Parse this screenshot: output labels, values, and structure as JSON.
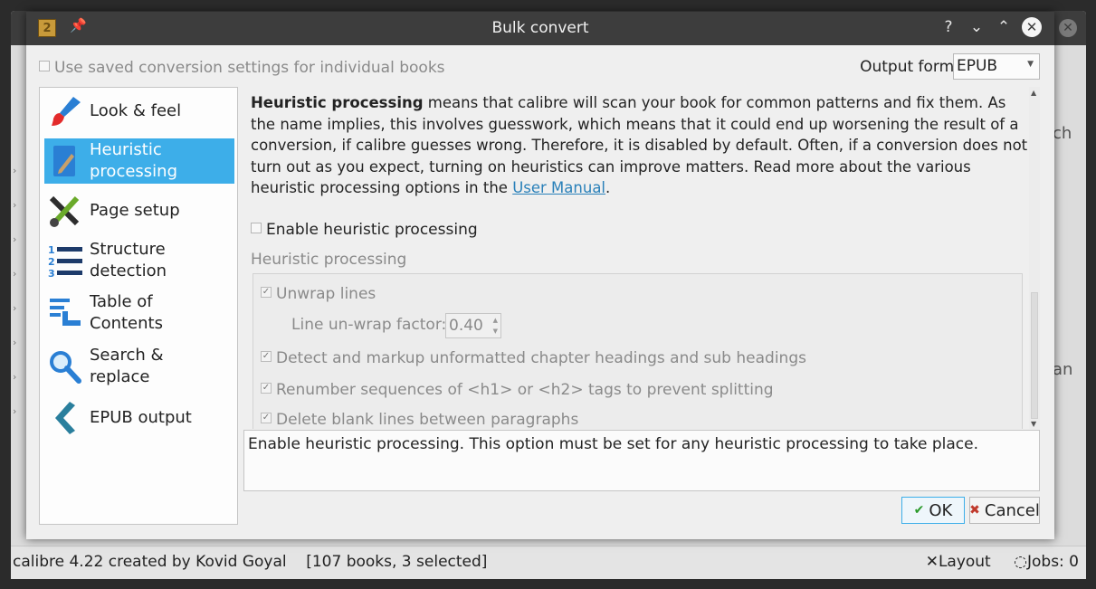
{
  "background": {
    "right_text_1": "ch",
    "right_text_2": "an",
    "status": {
      "left": "calibre 4.22 created by Kovid Goyal    [107 books, 3 selected]",
      "layout": "Layout",
      "jobs": "Jobs: 0"
    }
  },
  "dialog": {
    "title": "Bulk convert",
    "title_buttons": [
      "?",
      "⌄",
      "⌃",
      "✕"
    ],
    "use_saved_label": "Use saved conversion settings for individual books",
    "output_format_label": "Output format:",
    "output_format_value": "EPUB",
    "sidebar": [
      {
        "label": "Look & feel",
        "icon": "brush-icon"
      },
      {
        "label": "Heuristic processing",
        "icon": "pencil-icon",
        "selected": true
      },
      {
        "label": "Page setup",
        "icon": "tools-icon"
      },
      {
        "label": "Structure detection",
        "icon": "numbered-list-icon"
      },
      {
        "label": "Table of Contents",
        "icon": "toc-icon"
      },
      {
        "label": "Search & replace",
        "icon": "magnifier-icon"
      },
      {
        "label": "EPUB output",
        "icon": "chevron-left-icon"
      }
    ],
    "content": {
      "desc_bold": "Heuristic processing",
      "desc_text": " means that calibre will scan your book for common patterns and fix them. As the name implies, this involves guesswork, which means that it could end up worsening the result of a conversion, if calibre guesses wrong. Therefore, it is disabled by default. Often, if a conversion does not turn out as you expect, turning on heuristics can improve matters. Read more about the various heuristic processing options in the ",
      "desc_link": "User Manual",
      "desc_end": ".",
      "enable_label": "Enable heuristic processing",
      "group_title": "Heuristic processing",
      "options": [
        {
          "label": "Unwrap lines",
          "checked": true
        },
        {
          "label": "Detect and markup unformatted chapter headings and sub headings",
          "checked": true
        },
        {
          "label": "Renumber sequences of <h1> or <h2> tags to prevent splitting",
          "checked": true
        },
        {
          "label": "Delete blank lines between paragraphs",
          "checked": true
        }
      ],
      "unwrap_factor_label": "Line un-wrap factor:",
      "unwrap_factor_value": "0.40"
    },
    "help_text": "Enable heuristic processing. This option must be set for any heuristic processing to take place.",
    "ok_label": "OK",
    "cancel_label": "Cancel",
    "colors": {
      "selection": "#3daee9",
      "link": "#2980b9",
      "titlebar": "#3d3d3d"
    }
  }
}
